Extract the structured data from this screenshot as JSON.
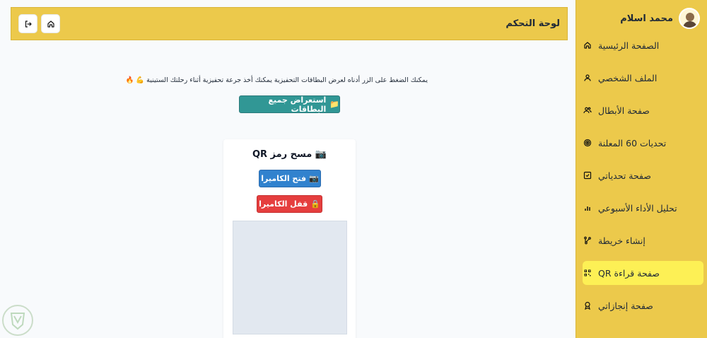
{
  "header": {
    "title": "لوحة التحكم",
    "home_icon": "home-icon",
    "logout_icon": "logout-icon"
  },
  "sidebar": {
    "user_name": "محمد اسلام",
    "items": [
      {
        "label": "الصفحة الرئيسية",
        "icon": "home-icon",
        "active": false
      },
      {
        "label": "الملف الشخصي",
        "icon": "user-icon",
        "active": false
      },
      {
        "label": "صفحة الأبطال",
        "icon": "users-icon",
        "active": false
      },
      {
        "label": "تحديات 60 المعلنة",
        "icon": "target-icon",
        "active": false
      },
      {
        "label": "صفحة تحدياتي",
        "icon": "checkbox-icon",
        "active": false
      },
      {
        "label": "تحليل الأداء الأسبوعي",
        "icon": "bar-chart-icon",
        "active": false
      },
      {
        "label": "إنشاء خريطة",
        "icon": "branch-icon",
        "active": false
      },
      {
        "label": "صفحة قراءة QR",
        "icon": "qr-icon",
        "active": true
      },
      {
        "label": "صفحة إنجازاتي",
        "icon": "award-icon",
        "active": false
      }
    ]
  },
  "main": {
    "info_text": "يمكنك الضغط على الزر أدناه لعرض البطاقات التحفيزية يمكنك أخذ جرعة تحفيزية أثناء رحلتك الستينية 💪 🔥",
    "browse_button": "استعراض جميع البطاقات",
    "browse_icon": "📁",
    "card": {
      "title": "مسح رمز QR",
      "title_icon": "📷",
      "open_camera": "فتح الكاميرا",
      "open_icon": "📷",
      "close_camera": "قفل الكاميرا",
      "close_icon": "🔒"
    }
  },
  "colors": {
    "sidebar_bg": "#ecc94b",
    "active_item": "#fdf055",
    "teal_button": "#319795",
    "blue_button": "#3182ce",
    "red_button": "#e53e3e"
  }
}
